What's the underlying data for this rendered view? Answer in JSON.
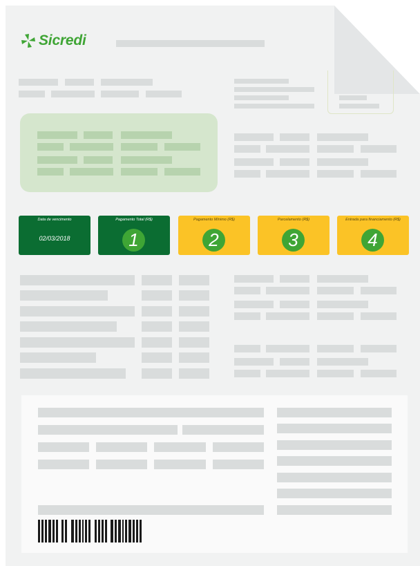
{
  "brand": {
    "name": "Sicredi",
    "logo_icon": "sicredi-pinwheel-icon",
    "color": "#3fa535"
  },
  "cards": [
    {
      "label": "Data de vencimento",
      "value": "02/03/2018",
      "style": "dark-green"
    },
    {
      "label": "Pagamento Total (R$)",
      "number": "1",
      "style": "dark-green"
    },
    {
      "label": "Pagamento Mínimo (R$)",
      "number": "2",
      "style": "yellow"
    },
    {
      "label": "Parcelamento (R$)",
      "number": "3",
      "style": "yellow"
    },
    {
      "label": "Entrada para financiamento (R$)",
      "number": "4",
      "style": "yellow"
    }
  ],
  "colors": {
    "dark_green": "#0b6d32",
    "light_green": "#3fa535",
    "yellow": "#fbc326",
    "placeholder": "#d9dcdc",
    "sheet": "#f1f2f2"
  }
}
